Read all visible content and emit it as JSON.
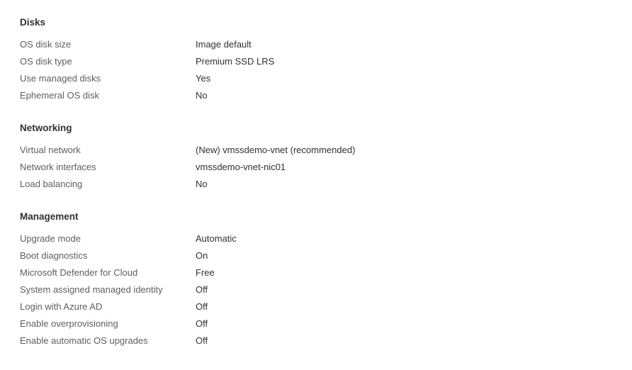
{
  "sections": [
    {
      "title": "Disks",
      "rows": [
        {
          "label": "OS disk size",
          "value": "Image default"
        },
        {
          "label": "OS disk type",
          "value": "Premium SSD LRS"
        },
        {
          "label": "Use managed disks",
          "value": "Yes"
        },
        {
          "label": "Ephemeral OS disk",
          "value": "No"
        }
      ]
    },
    {
      "title": "Networking",
      "rows": [
        {
          "label": "Virtual network",
          "value": "(New) vmssdemo-vnet (recommended)"
        },
        {
          "label": "Network interfaces",
          "value": "vmssdemo-vnet-nic01"
        },
        {
          "label": "Load balancing",
          "value": "No"
        }
      ]
    },
    {
      "title": "Management",
      "rows": [
        {
          "label": "Upgrade mode",
          "value": "Automatic"
        },
        {
          "label": "Boot diagnostics",
          "value": "On"
        },
        {
          "label": "Microsoft Defender for Cloud",
          "value": "Free"
        },
        {
          "label": "System assigned managed identity",
          "value": "Off"
        },
        {
          "label": "Login with Azure AD",
          "value": "Off"
        },
        {
          "label": "Enable overprovisioning",
          "value": "Off"
        },
        {
          "label": "Enable automatic OS upgrades",
          "value": "Off"
        }
      ]
    }
  ]
}
